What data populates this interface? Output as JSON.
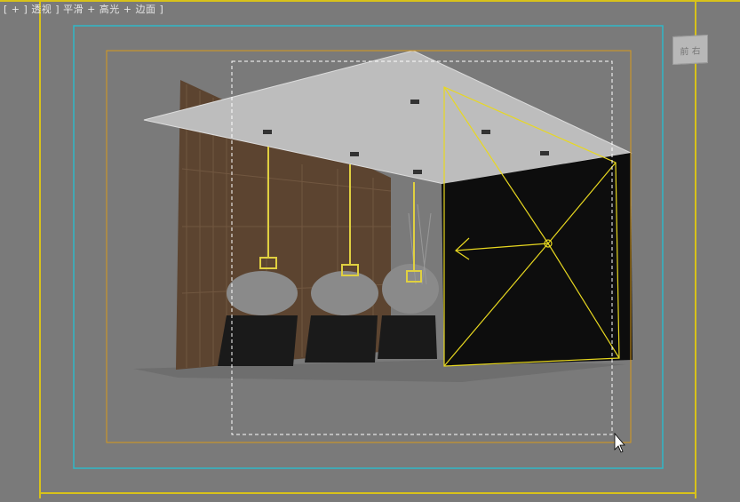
{
  "viewport": {
    "label": "[ + ] 透视 ] 平滑 + 高光 + 边面 ]",
    "viewcube_label": "前 右"
  },
  "colors": {
    "background": "#7a7a7a",
    "safe_frame_outer": "#d8c21a",
    "safe_frame_action": "#2fb8c8",
    "safe_frame_title": "#d89a1a",
    "region": "#ffffff",
    "camera": "#e8d820"
  }
}
